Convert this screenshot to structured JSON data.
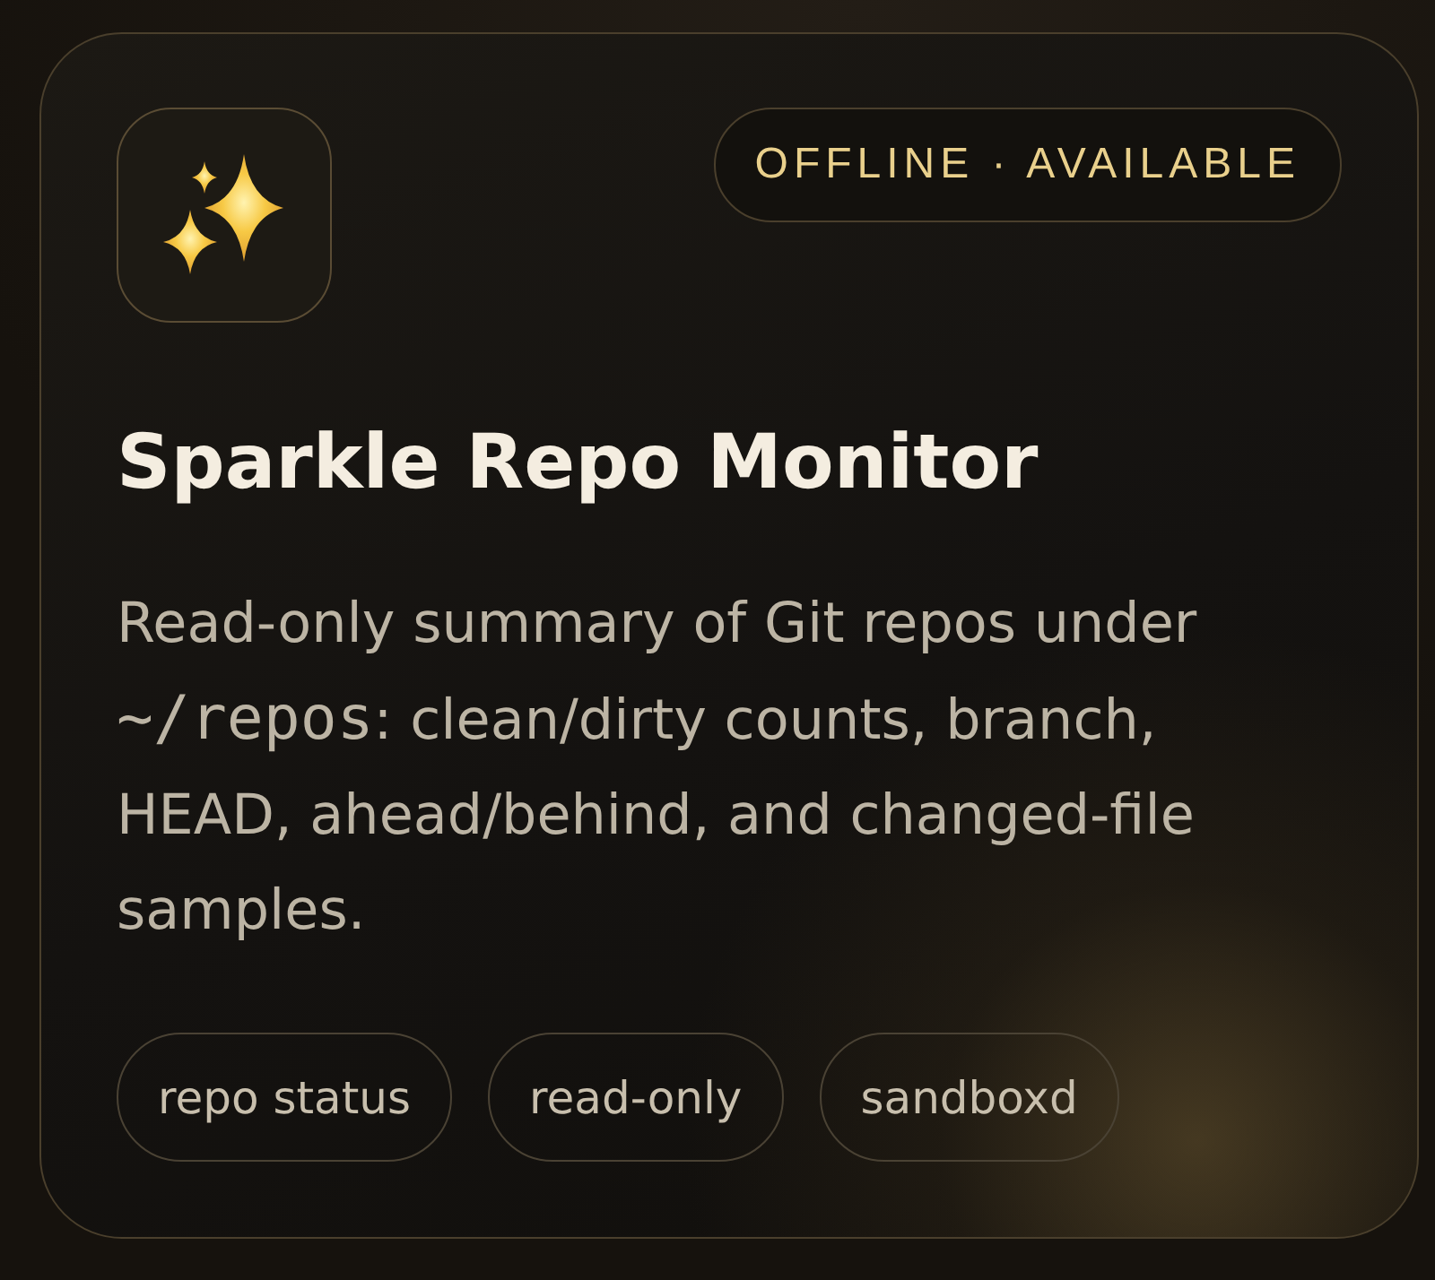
{
  "status_badge": {
    "text": "OFFLINE · AVAILABLE"
  },
  "title": "Sparkle Repo Monitor",
  "description": [
    {
      "kind": "text",
      "text": "Read-only summary of Git repos under "
    },
    {
      "kind": "code",
      "text": "~/repos"
    },
    {
      "kind": "text",
      "text": ": clean/dirty counts, branch, HEAD, ahead/behind, and changed-file samples."
    }
  ],
  "tags": [
    "repo status",
    "read-only",
    "sandboxd"
  ]
}
